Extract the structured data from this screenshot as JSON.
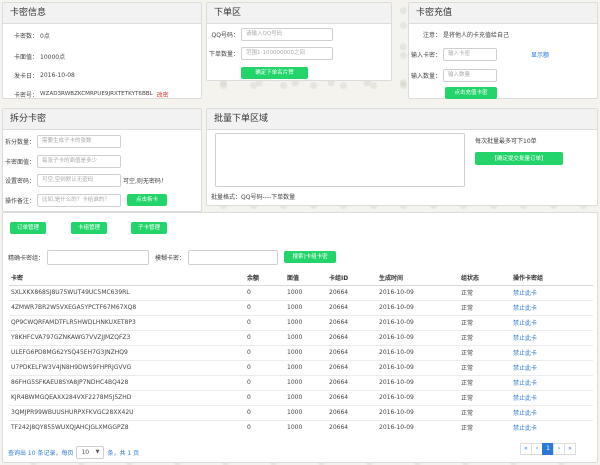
{
  "card_info": {
    "title": "卡密信息",
    "rows": [
      {
        "label": "卡密数：",
        "value": "0点"
      },
      {
        "label": "卡面值：",
        "value": "10000点"
      },
      {
        "label": "发卡日：",
        "value": "2016-10-08"
      },
      {
        "label": "卡密号：",
        "value": "WZAD3RWBZKCMRPUE9JRXTETKYT6BBL",
        "action": "改密"
      }
    ]
  },
  "order": {
    "title": "下单区",
    "qq_label": "QQ号码：",
    "qq_placeholder": "请输入QQ号码",
    "qty_label": "下单数量：",
    "qty_placeholder": "范围1-100000000之间",
    "submit": "确定下单名片赞"
  },
  "recharge": {
    "title": "卡密充值",
    "note_label": "注意：",
    "note_value": "是将他人的卡充值给自己",
    "card_label": "输入卡密：",
    "card_placeholder": "输入卡密",
    "show_link": "显示额",
    "qty_label": "输入数量：",
    "qty_placeholder": "输入数量",
    "submit": "点击充值卡密"
  },
  "split": {
    "title": "拆分卡密",
    "count_label": "拆分数量：",
    "count_placeholder": "需要生成子卡的张数",
    "value_label": "卡密面值：",
    "value_placeholder": "每张子卡的面值是多少",
    "pwd_label": "设置密码：",
    "pwd_placeholder": "可空,空则默认无密码",
    "pwd_hint": "可空,则无密码！",
    "remark_label": "操作备注：",
    "remark_placeholder": "比如,是什么的？卡给谁的？",
    "submit": "点击拆卡"
  },
  "batch": {
    "title": "批量下单区域",
    "hint": "每次批量最多可下10单",
    "submit": "【确定提交批量订单】",
    "format": "批量格式：QQ号码----下单数量"
  },
  "tabs": [
    "订单管理",
    "卡组管理",
    "子卡管理"
  ],
  "filters": {
    "exact_label": "精确卡密组：",
    "exact_placeholder": "",
    "fuzzy_label": "模糊卡密：",
    "fuzzy_placeholder": "",
    "search": "搜索]卡组卡密"
  },
  "table": {
    "headers": [
      "卡密",
      "余额",
      "面值",
      "卡组ID",
      "生成时间",
      "组状态",
      "操作卡密组"
    ],
    "rows": [
      [
        "SXLXKX868SJ8U75WUT49UC5MC639RL",
        "0",
        "1000",
        "20664",
        "2016-10-09",
        "正常",
        "禁止此卡"
      ],
      [
        "4ZMWR7BR2W5VXEGA5YPCTF67M67XQ8",
        "0",
        "1000",
        "20664",
        "2016-10-09",
        "正常",
        "禁止此卡"
      ],
      [
        "QP9CWQRFAMDTFLR5HWDLHNKUXET8P3",
        "0",
        "1000",
        "20664",
        "2016-10-09",
        "正常",
        "禁止此卡"
      ],
      [
        "Y8KHFCVA797GZNKAWG7VVZJJMZQFZ3",
        "0",
        "1000",
        "20664",
        "2016-10-09",
        "正常",
        "禁止此卡"
      ],
      [
        "ULEFG6PD8MG62YSQ45EH7G3JNZHQ9",
        "0",
        "1000",
        "20664",
        "2016-10-09",
        "正常",
        "禁止此卡"
      ],
      [
        "U7PDKELFW3V4JN8H9DWS9FHPRJGVVG",
        "0",
        "1000",
        "20664",
        "2016-10-09",
        "正常",
        "禁止此卡"
      ],
      [
        "86FHG5SFKAEU8SYA8JP7NDHC4BQ428",
        "0",
        "1000",
        "20664",
        "2016-10-09",
        "正常",
        "禁止此卡"
      ],
      [
        "KJR4BWMGQEAXX284VXF2278M5J5ZHD",
        "0",
        "1000",
        "20664",
        "2016-10-09",
        "正常",
        "禁止此卡"
      ],
      [
        "3QMJPR99WBUUSHURPXFKVGC28XX42U",
        "0",
        "1000",
        "20664",
        "2016-10-09",
        "正常",
        "禁止此卡"
      ],
      [
        "TF242J8QY855WUXQJAHCJGLXMGGPZ8",
        "0",
        "1000",
        "20664",
        "2016-10-09",
        "正常",
        "禁止此卡"
      ]
    ]
  },
  "footer": {
    "prefix": "查询出 10 条记录，每页",
    "page_size": "10",
    "suffix": "条，共 1 页",
    "pages": [
      "«",
      "‹",
      "1",
      "›",
      "»"
    ],
    "current_page": "1"
  },
  "colors": {
    "accent": "#22d46a",
    "link": "#2a7ad6",
    "danger": "#ee3333"
  }
}
